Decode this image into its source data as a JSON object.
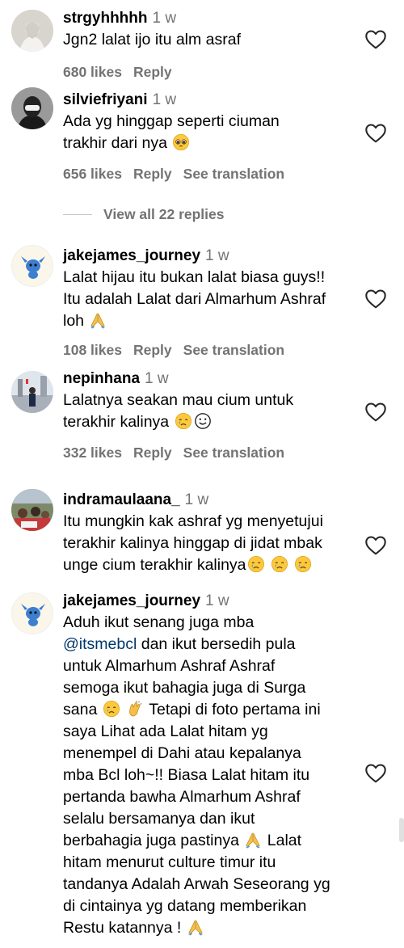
{
  "comments": [
    {
      "username": "strgyhhhhh",
      "time": "1 w",
      "lines": [
        "Jgn2 lalat ijo itu alm asraf"
      ],
      "likes": "680 likes",
      "reply": "Reply",
      "translate": ""
    },
    {
      "username": "silviefriyani",
      "time": "1 w",
      "lines": [
        "Ada yg hinggap seperti ciuman",
        "trakhir dari nya"
      ],
      "likes": "656 likes",
      "reply": "Reply",
      "translate": "See translation"
    },
    {
      "username": "jakejames_journey",
      "time": "1 w",
      "lines": [
        "Lalat hijau itu bukan lalat biasa guys!!",
        "Itu adalah Lalat dari Almarhum Ashraf",
        "loh"
      ],
      "likes": "108 likes",
      "reply": "Reply",
      "translate": "See translation"
    },
    {
      "username": "nepinhana",
      "time": "1 w",
      "lines": [
        "Lalatnya seakan mau cium untuk",
        "terakhir kalinya"
      ],
      "likes": "332 likes",
      "reply": "Reply",
      "translate": "See translation"
    },
    {
      "username": "indramaulaana_",
      "time": "1 w",
      "lines": [
        "Itu mungkin kak ashraf yg menyetujui",
        "terakhir kalinya hinggap di jidat mbak",
        "unge cium terakhir kalinya"
      ],
      "likes": "",
      "reply": "",
      "translate": ""
    },
    {
      "username": "jakejames_journey",
      "time": "1 w",
      "lines": [
        "Aduh ikut senang juga mba",
        "@itsmebcl",
        " dan ikut bersedih pula",
        "untuk Almarhum Ashraf Ashraf",
        "semoga ikut bahagia juga di Surga",
        "sana",
        "Tetapi di foto pertama ini",
        "saya Lihat ada Lalat hitam yg",
        "menempel di Dahi atau kepalanya",
        "mba Bcl loh~!! Biasa Lalat hitam itu",
        "pertanda bawha Almarhum Ashraf",
        "selalu bersamanya dan ikut",
        "berbahagia juga pastinya",
        "Lalat",
        "hitam menurut culture timur itu",
        "tandanya Adalah Arwah Seseorang yg",
        "di cintainya yg datang memberikan",
        "Restu katannya !"
      ],
      "likes": "",
      "reply": "",
      "translate": ""
    }
  ],
  "view_replies": "View all 22 replies",
  "colors": {
    "secondary": "#737373",
    "mention": "#00376b",
    "heart_stroke": "#262626"
  },
  "icons": [
    "heart-outline-icon",
    "pleading-face-emoji",
    "folded-hands-emoji",
    "crying-face-emoji",
    "smiling-face-emoji",
    "clapping-hands-emoji"
  ]
}
